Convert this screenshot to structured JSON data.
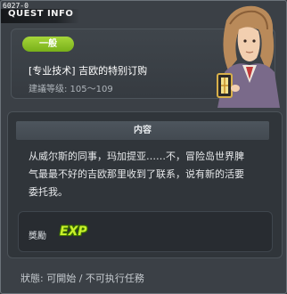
{
  "window": {
    "id_label": "6027-0",
    "title": "QUEST INFO"
  },
  "quest": {
    "level_badge": "一般",
    "name": "[专业技术] 吉欧的特别订购",
    "recommended_level": "建議等级: 105～109"
  },
  "content": {
    "header": "内容",
    "lines": [
      "从威尔斯的同事，玛加提亚……不，冒险岛世界脾",
      "气最最不好的吉欧那里收到了联系，说有新的活要",
      "委托我。"
    ]
  },
  "reward": {
    "label": "獎勵",
    "icon_text": "EXP"
  },
  "status": {
    "text": "狀態: 可開始 / 不可执行任務"
  },
  "colors": {
    "badge": "#8cc226",
    "window_bg": "#3b4046",
    "exp": "#c8f02a"
  }
}
